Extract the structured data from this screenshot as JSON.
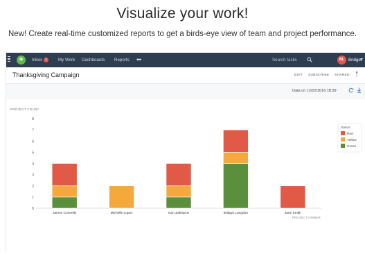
{
  "hero": {
    "headline": "Visualize your work!",
    "subheadline": "New! Create real-time customized reports to get a birds-eye view of team and project performance."
  },
  "topbar": {
    "nav": [
      {
        "label": "Inbox",
        "badge": "1"
      },
      {
        "label": "My Work"
      },
      {
        "label": "Dashboards"
      },
      {
        "label": "Reports"
      }
    ],
    "search_placeholder": "Search tasks",
    "user_initials": "BL",
    "user_name": "Bridget"
  },
  "report": {
    "title": "Thanksgiving Campaign",
    "actions": {
      "edit": "EDIT",
      "subscribe": "SUBSCRIBE",
      "shared": "SHARED"
    },
    "data_on": "Data on 12/22/2016 18:39"
  },
  "colors": {
    "red": "#e15a47",
    "yellow": "#f5a83b",
    "green": "#5a8f3c"
  },
  "chart_data": {
    "type": "bar",
    "stacked": true,
    "ylabel": "PROJECT COUNT",
    "xlabel": "PROJECT OWNER",
    "ylim": [
      0,
      8
    ],
    "yticks": [
      0,
      1,
      2,
      3,
      4,
      5,
      6,
      7,
      8
    ],
    "categories": [
      "James Connelly",
      "Michelle Lopez",
      "Ivan Zakharov",
      "Bridget Langdon",
      "Jane Smith"
    ],
    "series": [
      {
        "name": "Green",
        "color": "#5a8f3c",
        "values": [
          1,
          0,
          1,
          4,
          0
        ]
      },
      {
        "name": "Yellow",
        "color": "#f5a83b",
        "values": [
          1,
          2,
          1,
          1,
          0
        ]
      },
      {
        "name": "Red",
        "color": "#e15a47",
        "values": [
          2,
          0,
          2,
          2,
          2
        ]
      }
    ],
    "legend": {
      "title": "Status",
      "order": [
        "Red",
        "Yellow",
        "Green"
      ],
      "placement": "top-right"
    },
    "grid": false
  }
}
